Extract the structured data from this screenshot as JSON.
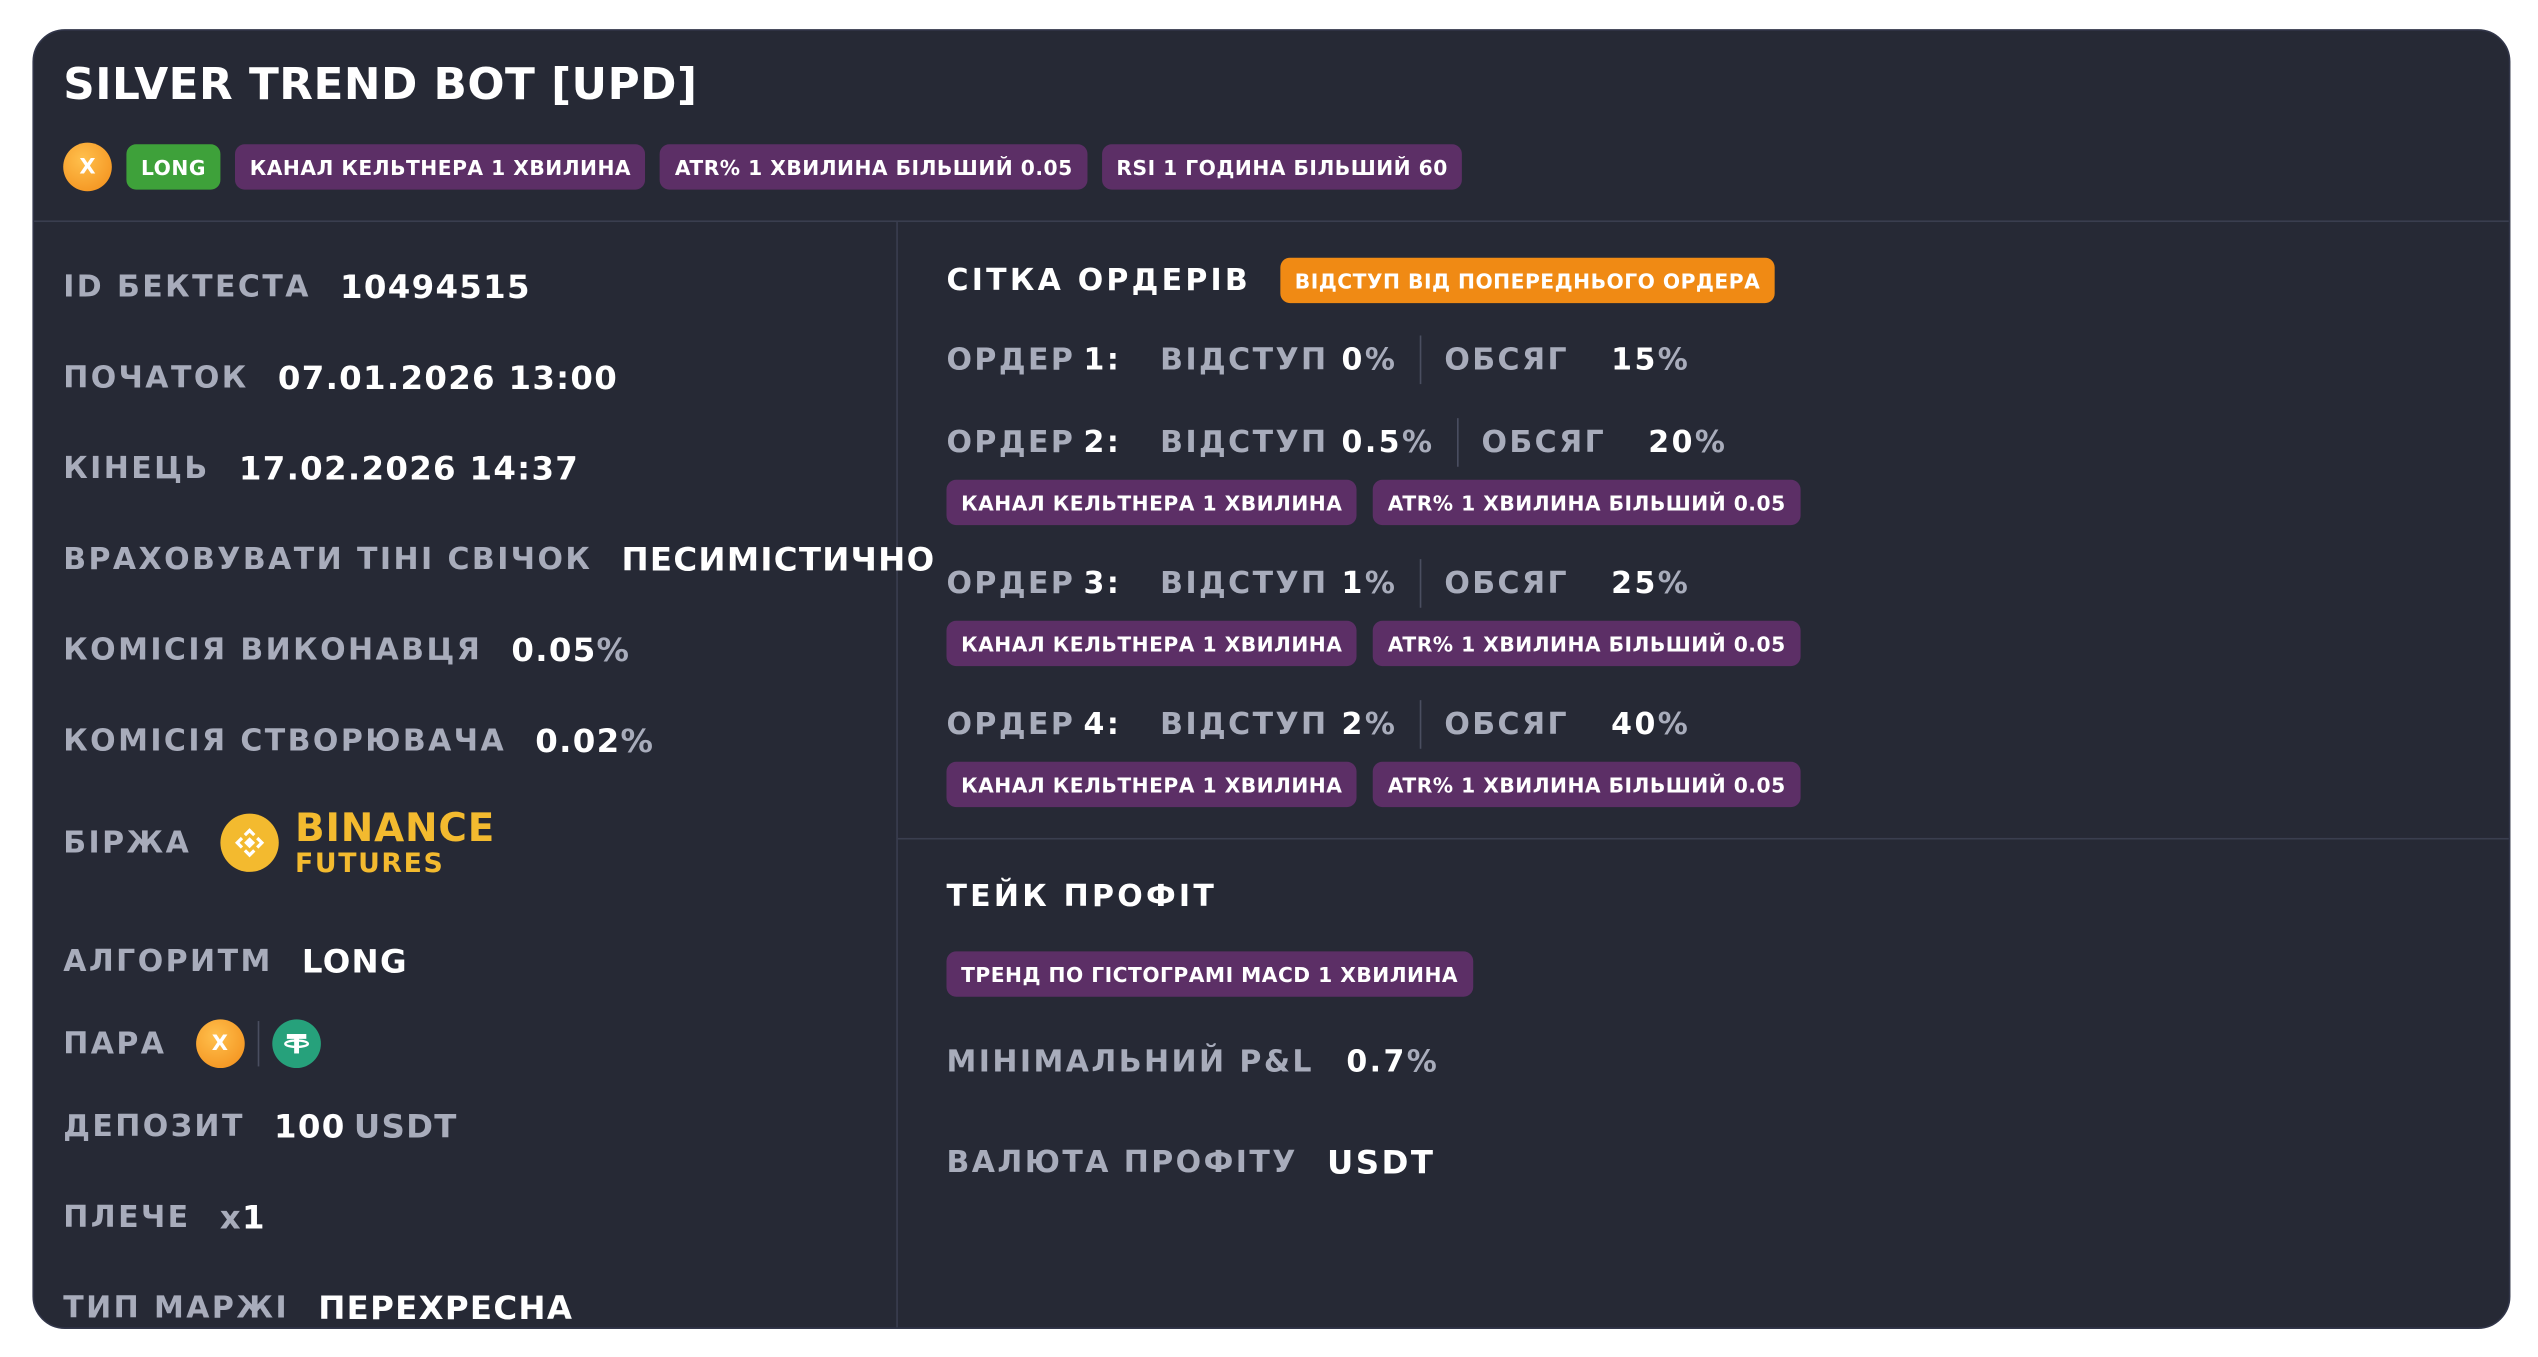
{
  "title": "SILVER TREND BOT [UPD]",
  "header": {
    "coin_symbol": "X",
    "direction_tag": "LONG",
    "conditions": [
      "КАНАЛ КЕЛЬТНЕРА 1 ХВИЛИНА",
      "ATR% 1 ХВИЛИНА БІЛЬШИЙ 0.05",
      "RSI 1 ГОДИНА БІЛЬШИЙ 60"
    ]
  },
  "details": {
    "backtest_id": {
      "label": "ID БЕКТЕСТА",
      "value": "10494515"
    },
    "start": {
      "label": "ПОЧАТОК",
      "value": "07.01.2026 13:00"
    },
    "end": {
      "label": "КІНЕЦЬ",
      "value": "17.02.2026 14:37"
    },
    "shadows": {
      "label": "ВРАХОВУВАТИ ТІНІ СВІЧОК",
      "value": "ПЕСИМІСТИЧНО"
    },
    "taker_fee": {
      "label": "КОМІСІЯ ВИКОНАВЦЯ",
      "value": "0.05",
      "unit": "%"
    },
    "maker_fee": {
      "label": "КОМІСІЯ СТВОРЮВАЧА",
      "value": "0.02",
      "unit": "%"
    },
    "exchange": {
      "label": "БІРЖА",
      "name": "BINANCE",
      "sub": "FUTURES"
    },
    "algorithm": {
      "label": "АЛГОРИТМ",
      "value": "LONG"
    },
    "pair": {
      "label": "ПАРА",
      "base_symbol": "X",
      "quote_icon": "tether-icon"
    },
    "deposit": {
      "label": "ДЕПОЗИТ",
      "value": "100",
      "unit": "USDT"
    },
    "leverage": {
      "label": "ПЛЕЧЕ",
      "prefix": "x",
      "value": "1"
    },
    "margin_type": {
      "label": "ТИП МАРЖІ",
      "value": "ПЕРЕХРЕСНА"
    }
  },
  "order_grid": {
    "title": "СІТКА ОРДЕРІВ",
    "mode_tag": "ВІДСТУП ВІД ПОПЕРЕДНЬОГО ОРДЕРА",
    "order_label": "ОРДЕР",
    "offset_label": "ВІДСТУП",
    "volume_label": "ОБСЯГ",
    "orders": [
      {
        "num": "1:",
        "offset": "0",
        "volume": "15",
        "tags": []
      },
      {
        "num": "2:",
        "offset": "0.5",
        "volume": "20",
        "tags": [
          "КАНАЛ КЕЛЬТНЕРА 1 ХВИЛИНА",
          "ATR% 1 ХВИЛИНА БІЛЬШИЙ 0.05"
        ]
      },
      {
        "num": "3:",
        "offset": "1",
        "volume": "25",
        "tags": [
          "КАНАЛ КЕЛЬТНЕРА 1 ХВИЛИНА",
          "ATR% 1 ХВИЛИНА БІЛЬШИЙ 0.05"
        ]
      },
      {
        "num": "4:",
        "offset": "2",
        "volume": "40",
        "tags": [
          "КАНАЛ КЕЛЬТНЕРА 1 ХВИЛИНА",
          "ATR% 1 ХВИЛИНА БІЛЬШИЙ 0.05"
        ]
      }
    ],
    "percent": "%"
  },
  "take_profit": {
    "title": "ТЕЙК ПРОФІТ",
    "condition": "ТРЕНД ПО ГІСТОГРАМІ MACD 1 ХВИЛИНА",
    "min_pnl": {
      "label": "МІНІМАЛЬНИЙ P&L",
      "value": "0.7",
      "unit": "%"
    },
    "currency": {
      "label": "ВАЛЮТА ПРОФІТУ",
      "value": "USDT"
    }
  },
  "colors": {
    "card_bg": "#262935",
    "label_gray": "#a8acbb",
    "long_green": "#3ea13a",
    "tag_purple": "#5c2f66",
    "tag_orange": "#f08a14",
    "binance_yellow": "#f3ba2f",
    "tether_green": "#26a17b",
    "coin_orange": "#f28c18"
  }
}
